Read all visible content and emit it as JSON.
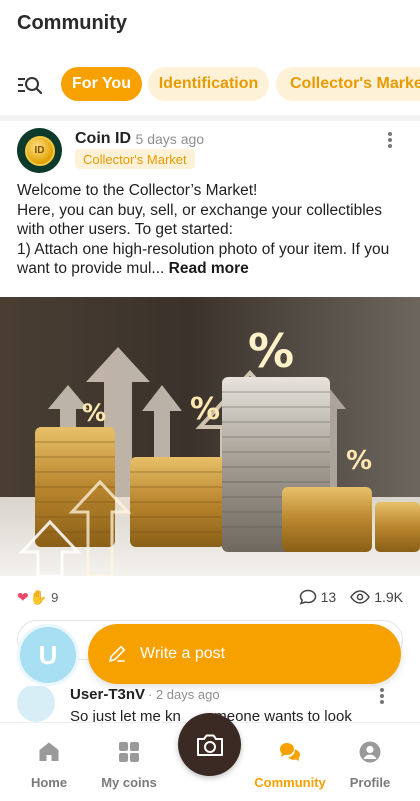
{
  "header": {
    "title": "Community"
  },
  "filters": {
    "icon": "search-filter-icon",
    "chips": [
      {
        "label": "For You",
        "active": true
      },
      {
        "label": "Identification",
        "active": false
      },
      {
        "label": "Collector's Market",
        "active": false
      }
    ]
  },
  "post": {
    "author": "Coin ID",
    "time": "· 5 days ago",
    "tag": "Collector's Market",
    "avatar_text": "ID",
    "body_lines": [
      "Welcome to the Collector’s Market!",
      "Here, you can buy, sell, or exchange your collectibles with other users. To get started:",
      "1) Attach one high-resolution photo of your item. If you want to provide mul..."
    ],
    "read_more": "Read more",
    "reaction_count": "9",
    "comment_count": "13",
    "view_count": "1.9K",
    "image_alt": "stacks of coins with rising arrows and percent signs"
  },
  "fab": {
    "write_label": "Write a post",
    "user_initial": "U"
  },
  "next_post": {
    "author": "User-T3nV",
    "time": "· 2 days ago",
    "text": "So just let me kn___omeone wants to look"
  },
  "nav": {
    "home": "Home",
    "coins": "My coins",
    "community": "Community",
    "profile": "Profile"
  },
  "colors": {
    "accent": "#f7a100",
    "chip_bg": "#fdf2d8",
    "camera": "#3b2a24"
  }
}
